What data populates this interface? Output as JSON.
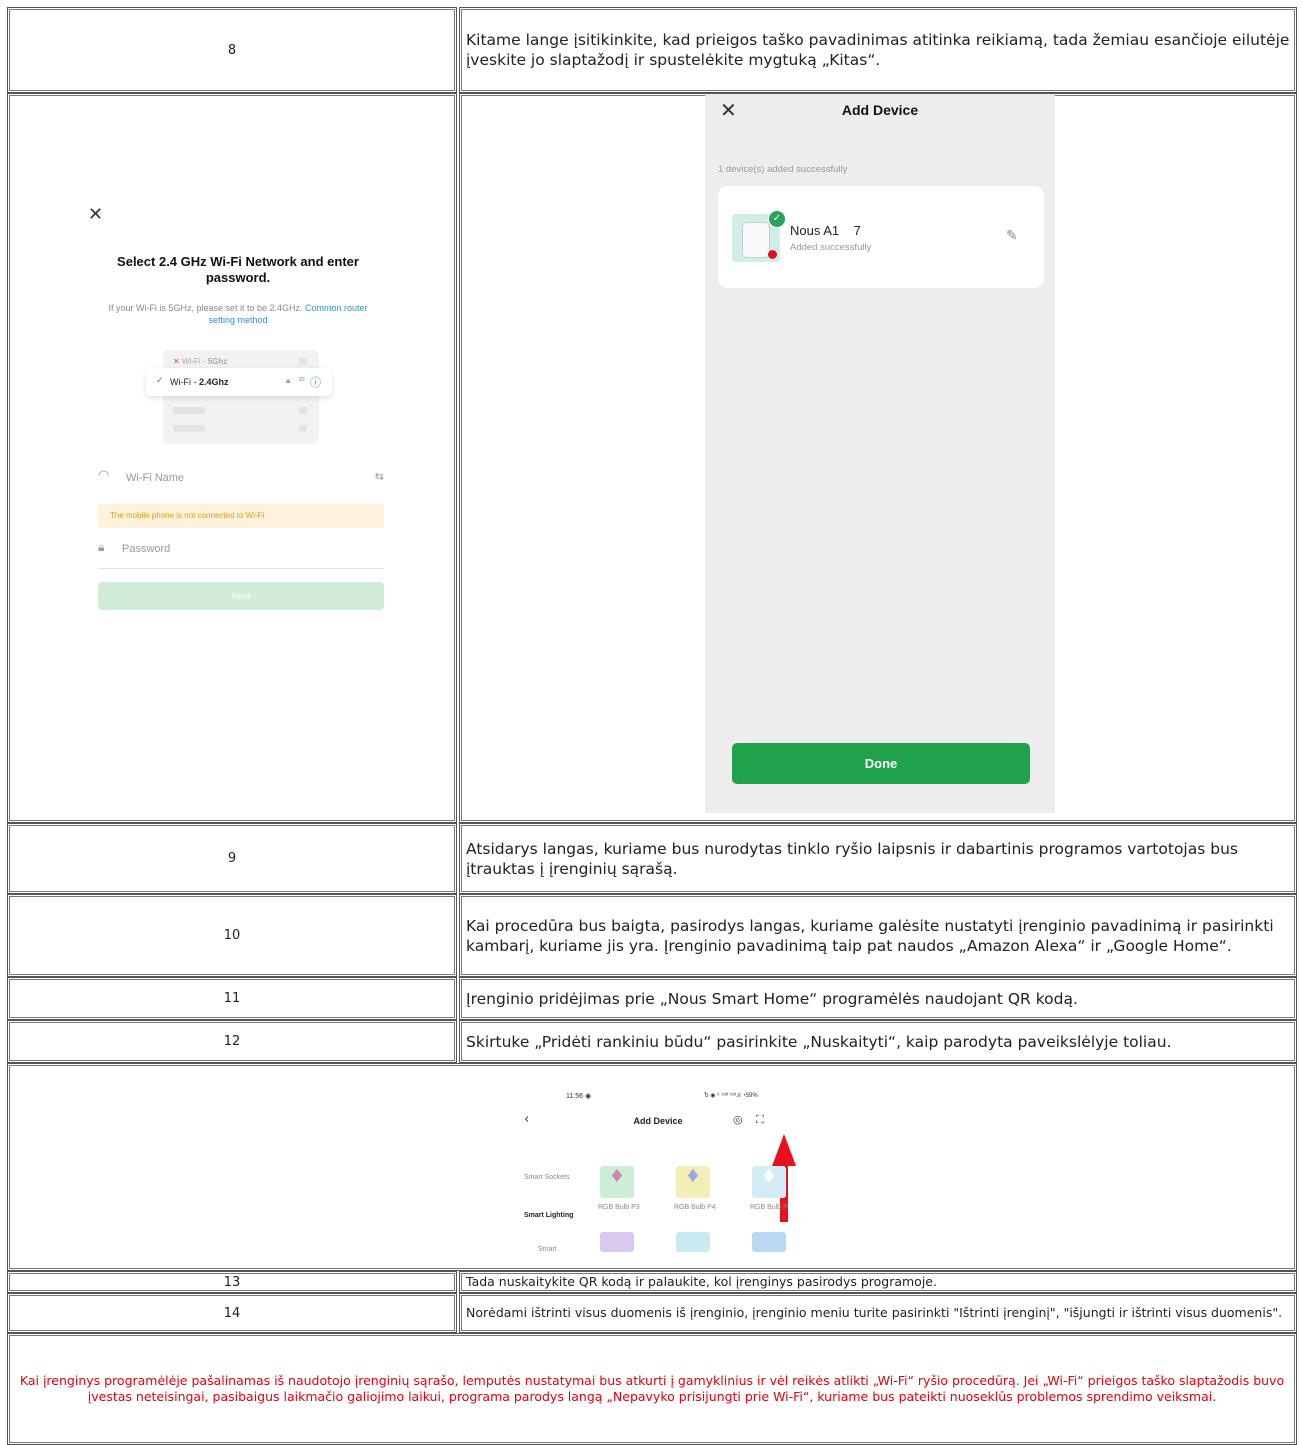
{
  "rows": [
    {
      "num": "8",
      "text": "Kitame lange įsitikinkite, kad prieigos taško pavadinimas atitinka reikiamą, tada žemiau esančioje eilutėje įveskite jo slaptažodį ir spustelėkite mygtuką „Kitas“."
    },
    {
      "num": "9",
      "text": "Atsidarys langas, kuriame bus nurodytas tinklo ryšio laipsnis ir dabartinis programos vartotojas bus įtrauktas į įrenginių sąrašą."
    },
    {
      "num": "10",
      "text": "Kai procedūra bus baigta, pasirodys langas, kuriame galėsite nustatyti įrenginio pavadinimą ir pasirinkti kambarį, kuriame jis yra. Įrenginio pavadinimą taip pat naudos „Amazon Alexa“ ir „Google Home“."
    },
    {
      "num": "11",
      "text": "Įrenginio pridėjimas prie „Nous Smart Home“ programėlės naudojant QR kodą."
    },
    {
      "num": "12",
      "text": "Skirtuke „Pridėti rankiniu būdu“ pasirinkite „Nuskaityti“, kaip parodyta paveikslėlyje toliau."
    },
    {
      "num": "13",
      "text": "Tada nuskaitykite QR kodą ir palaukite, kol įrenginys pasirodys programoje."
    },
    {
      "num": "14",
      "text": "Norėdami ištrinti visus duomenis iš įrenginio, įrenginio meniu turite pasirinkti \"Ištrinti įrenginį\", \"išjungti ir ištrinti visus duomenis\"."
    }
  ],
  "footer_note": "Kai įrenginys programėlėje pašalinamas iš naudotojo įrenginių sąrašo, lemputės nustatymai bus atkurti į gamyklinius ir vėl reikės atlikti „Wi-Fi“ ryšio procedūrą. Jei „Wi-Fi“ prieigos taško slaptažodis buvo įvestas neteisingai, pasibaigus laikmačio galiojimo laikui, programa parodys langą „Nepavyko prisijungti prie Wi-Fi“, kuriame bus pateikti nuoseklūs problemos sprendimo veiksmai.",
  "colors": {
    "warning_text": "#e8000b",
    "done_green": "#1fa24c",
    "link_blue": "#2f8fe0",
    "arrow_red": "#e8121c"
  },
  "wifi_screen": {
    "close_icon": "close-icon",
    "title": "Select 2.4 GHz Wi-Fi Network and enter password.",
    "subtitle": "If your Wi-Fi is 5GHz, please set it to be 2.4GHz.",
    "subtitle_link": "Common router setting method",
    "net_5ghz_prefix": "Wi-Fi - ",
    "net_5ghz_band": "5Ghz",
    "net_24_prefix": "Wi-Fi - ",
    "net_24_band": "2.4Ghz",
    "wifi_name_placeholder": "Wi-Fi Name",
    "warning": "The mobile phone is not connected to Wi-Fi.",
    "password_placeholder": "Password",
    "next_button": "Next"
  },
  "add_device_screen": {
    "title": "Add Device",
    "count_text": "1 device(s) added successfully",
    "device_name": "Nous A1",
    "device_suffix": "7",
    "device_status": "Added successfully",
    "done_button": "Done"
  },
  "scan_screen": {
    "time": "11:56",
    "status_right": "Ⴆ ◉ ⁶ ⁵⁶ᴵᴵ ⁵⁸ᴵ.ıl ◔59%",
    "title": "Add Device",
    "categories": [
      "Smart Sockets",
      "Smart Lighting",
      "Smart"
    ],
    "products": [
      "RGB Bulb P3",
      "RGB Bulb P4",
      "RGB Bulb P"
    ]
  }
}
